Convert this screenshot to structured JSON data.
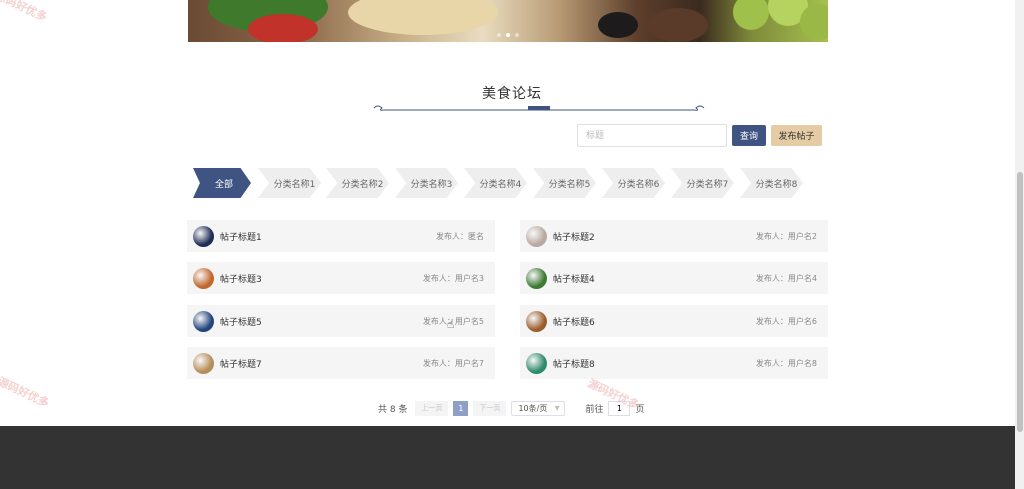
{
  "banner": {
    "slide_count": 3,
    "active_slide": 2
  },
  "section": {
    "title": "美食论坛"
  },
  "search": {
    "placeholder": "标题",
    "query_label": "查询",
    "publish_label": "发布帖子"
  },
  "categories": [
    "全部",
    "分类名称1",
    "分类名称2",
    "分类名称3",
    "分类名称4",
    "分类名称5",
    "分类名称6",
    "分类名称7",
    "分类名称8"
  ],
  "posts": [
    {
      "title": "帖子标题1",
      "author_prefix": "发布人：",
      "author": "匿名",
      "avatar_color": "#1f2c55"
    },
    {
      "title": "帖子标题2",
      "author_prefix": "发布人：",
      "author": "用户名2",
      "avatar_color": "#b8a9a0"
    },
    {
      "title": "帖子标题3",
      "author_prefix": "发布人：",
      "author": "用户名3",
      "avatar_color": "#c2672c"
    },
    {
      "title": "帖子标题4",
      "author_prefix": "发布人：",
      "author": "用户名4",
      "avatar_color": "#3e7a34"
    },
    {
      "title": "帖子标题5",
      "author_prefix": "发布人：",
      "author": "用户名5",
      "avatar_color": "#23457e"
    },
    {
      "title": "帖子标题6",
      "author_prefix": "发布人：",
      "author": "用户名6",
      "avatar_color": "#9a5d2c"
    },
    {
      "title": "帖子标题7",
      "author_prefix": "发布人：",
      "author": "用户名7",
      "avatar_color": "#b58d5a"
    },
    {
      "title": "帖子标题8",
      "author_prefix": "发布人：",
      "author": "用户名8",
      "avatar_color": "#2f8a6a"
    }
  ],
  "pagination": {
    "total": "共 8 条",
    "prev": "上一页",
    "current": "1",
    "next": "下一页",
    "page_size": "10条/页",
    "goto_prefix": "前往",
    "goto_value": "1",
    "goto_suffix": "页"
  },
  "colors": {
    "primary": "#3f5483",
    "accent": "#e5cca5",
    "footer": "#333333"
  },
  "watermark": "源码好优多"
}
